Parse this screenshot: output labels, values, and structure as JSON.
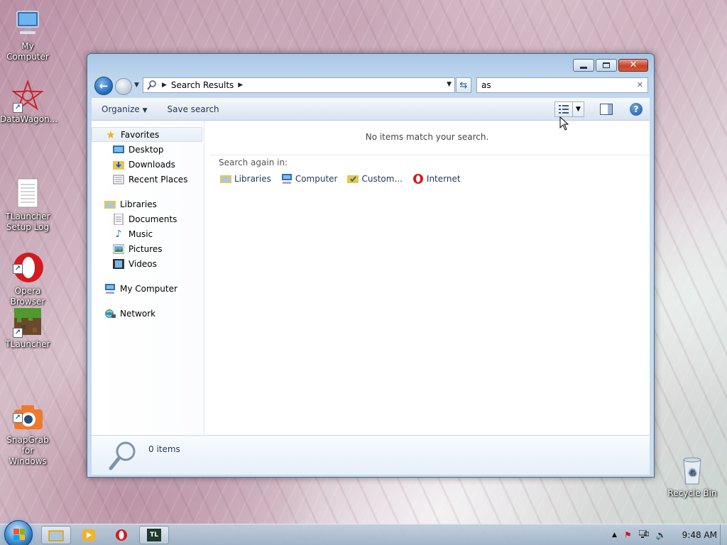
{
  "desktop": {
    "icons": [
      {
        "label": "My Computer"
      },
      {
        "label": "DataWagon..."
      },
      {
        "label": "TLauncher\nSetup Log"
      },
      {
        "label": "Opera\nBrowser"
      },
      {
        "label": "TLauncher"
      },
      {
        "label": "SnapGrab for\nWindows"
      },
      {
        "label": "Recycle Bin"
      }
    ]
  },
  "window": {
    "address": {
      "segment": "Search Results"
    },
    "search": {
      "value": "as"
    },
    "toolbar": {
      "organize": "Organize",
      "save_search": "Save search"
    },
    "nav": {
      "favorites": {
        "label": "Favorites",
        "items": [
          "Desktop",
          "Downloads",
          "Recent Places"
        ]
      },
      "libraries": {
        "label": "Libraries",
        "items": [
          "Documents",
          "Music",
          "Pictures",
          "Videos"
        ]
      },
      "computer": "My Computer",
      "network": "Network"
    },
    "main": {
      "empty_message": "No items match your search.",
      "search_again_label": "Search again in:",
      "search_again_items": [
        "Libraries",
        "Computer",
        "Custom...",
        "Internet"
      ]
    },
    "details": {
      "count": "0 items"
    }
  },
  "taskbar": {
    "tl_label": "TL",
    "clock": "9:48 AM"
  },
  "colors": {
    "accent": "#1e395b",
    "opera": "#d41a1f",
    "start": "#3a88cf"
  }
}
